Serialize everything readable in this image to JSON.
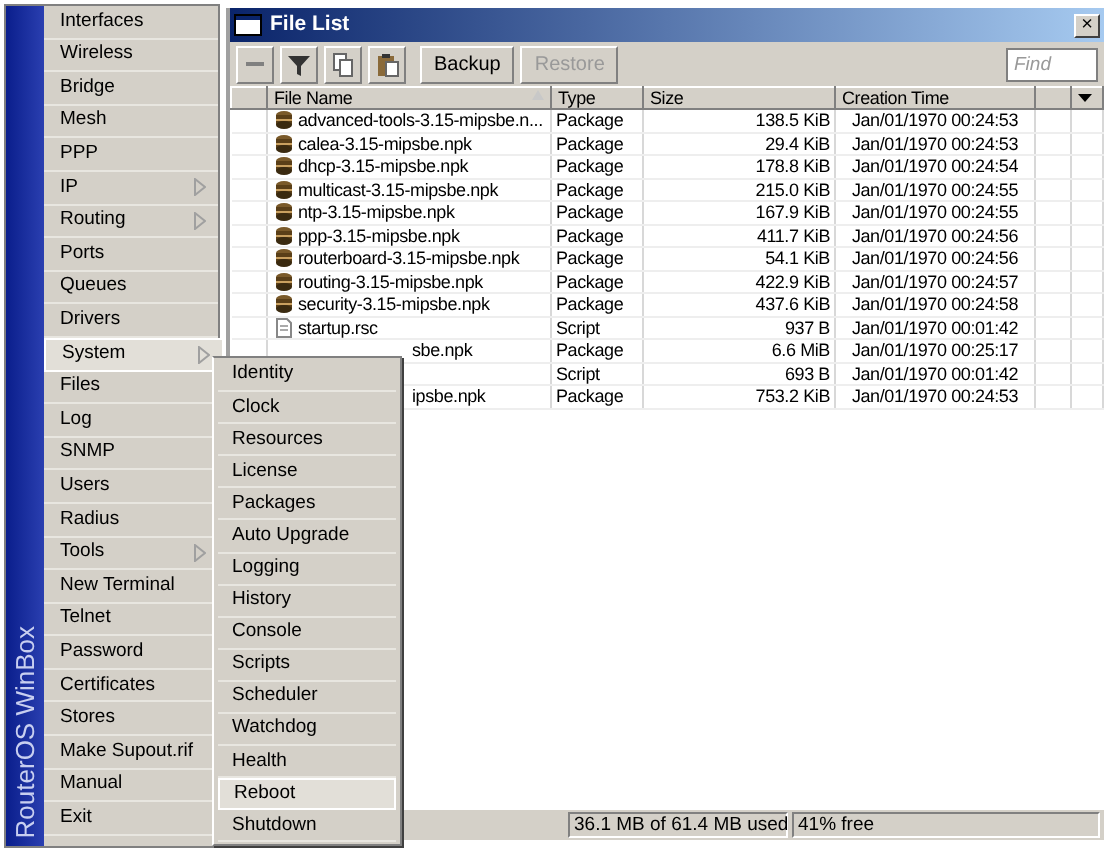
{
  "sidebar": {
    "brand": "RouterOS WinBox",
    "items": [
      {
        "label": "Interfaces",
        "submenu": false,
        "selected": false
      },
      {
        "label": "Wireless",
        "submenu": false,
        "selected": false
      },
      {
        "label": "Bridge",
        "submenu": false,
        "selected": false
      },
      {
        "label": "Mesh",
        "submenu": false,
        "selected": false
      },
      {
        "label": "PPP",
        "submenu": false,
        "selected": false
      },
      {
        "label": "IP",
        "submenu": true,
        "selected": false
      },
      {
        "label": "Routing",
        "submenu": true,
        "selected": false
      },
      {
        "label": "Ports",
        "submenu": false,
        "selected": false
      },
      {
        "label": "Queues",
        "submenu": false,
        "selected": false
      },
      {
        "label": "Drivers",
        "submenu": false,
        "selected": false
      },
      {
        "label": "System",
        "submenu": true,
        "selected": true
      },
      {
        "label": "Files",
        "submenu": false,
        "selected": false
      },
      {
        "label": "Log",
        "submenu": false,
        "selected": false
      },
      {
        "label": "SNMP",
        "submenu": false,
        "selected": false
      },
      {
        "label": "Users",
        "submenu": false,
        "selected": false
      },
      {
        "label": "Radius",
        "submenu": false,
        "selected": false
      },
      {
        "label": "Tools",
        "submenu": true,
        "selected": false
      },
      {
        "label": "New Terminal",
        "submenu": false,
        "selected": false
      },
      {
        "label": "Telnet",
        "submenu": false,
        "selected": false
      },
      {
        "label": "Password",
        "submenu": false,
        "selected": false
      },
      {
        "label": "Certificates",
        "submenu": false,
        "selected": false
      },
      {
        "label": "Stores",
        "submenu": false,
        "selected": false
      },
      {
        "label": "Make Supout.rif",
        "submenu": false,
        "selected": false
      },
      {
        "label": "Manual",
        "submenu": false,
        "selected": false
      },
      {
        "label": "Exit",
        "submenu": false,
        "selected": false
      }
    ]
  },
  "submenu": {
    "items": [
      {
        "label": "Identity",
        "selected": false
      },
      {
        "label": "Clock",
        "selected": false
      },
      {
        "label": "Resources",
        "selected": false
      },
      {
        "label": "License",
        "selected": false
      },
      {
        "label": "Packages",
        "selected": false
      },
      {
        "label": "Auto Upgrade",
        "selected": false
      },
      {
        "label": "Logging",
        "selected": false
      },
      {
        "label": "History",
        "selected": false
      },
      {
        "label": "Console",
        "selected": false
      },
      {
        "label": "Scripts",
        "selected": false
      },
      {
        "label": "Scheduler",
        "selected": false
      },
      {
        "label": "Watchdog",
        "selected": false
      },
      {
        "label": "Health",
        "selected": false
      },
      {
        "label": "Reboot",
        "selected": true
      },
      {
        "label": "Shutdown",
        "selected": false
      }
    ]
  },
  "window": {
    "title": "File List",
    "close": "×",
    "toolbar": {
      "buttons": [
        {
          "label": "Backup",
          "disabled": false
        },
        {
          "label": "Restore",
          "disabled": true
        }
      ],
      "find_placeholder": "Find"
    },
    "table": {
      "columns": [
        "File Name",
        "Type",
        "Size",
        "Creation Time"
      ],
      "rows": [
        {
          "kind": "package",
          "name": "advanced-tools-3.15-mipsbe.n...",
          "type": "Package",
          "size": "138.5 KiB",
          "time": "Jan/01/1970 00:24:53"
        },
        {
          "kind": "package",
          "name": "calea-3.15-mipsbe.npk",
          "type": "Package",
          "size": "29.4 KiB",
          "time": "Jan/01/1970 00:24:53"
        },
        {
          "kind": "package",
          "name": "dhcp-3.15-mipsbe.npk",
          "type": "Package",
          "size": "178.8 KiB",
          "time": "Jan/01/1970 00:24:54"
        },
        {
          "kind": "package",
          "name": "multicast-3.15-mipsbe.npk",
          "type": "Package",
          "size": "215.0 KiB",
          "time": "Jan/01/1970 00:24:55"
        },
        {
          "kind": "package",
          "name": "ntp-3.15-mipsbe.npk",
          "type": "Package",
          "size": "167.9 KiB",
          "time": "Jan/01/1970 00:24:55"
        },
        {
          "kind": "package",
          "name": "ppp-3.15-mipsbe.npk",
          "type": "Package",
          "size": "411.7 KiB",
          "time": "Jan/01/1970 00:24:56"
        },
        {
          "kind": "package",
          "name": "routerboard-3.15-mipsbe.npk",
          "type": "Package",
          "size": "54.1 KiB",
          "time": "Jan/01/1970 00:24:56"
        },
        {
          "kind": "package",
          "name": "routing-3.15-mipsbe.npk",
          "type": "Package",
          "size": "422.9 KiB",
          "time": "Jan/01/1970 00:24:57"
        },
        {
          "kind": "package",
          "name": "security-3.15-mipsbe.npk",
          "type": "Package",
          "size": "437.6 KiB",
          "time": "Jan/01/1970 00:24:58"
        },
        {
          "kind": "script",
          "name": "startup.rsc",
          "type": "Script",
          "size": "937 B",
          "time": "Jan/01/1970 00:01:42"
        },
        {
          "kind": "hidden",
          "name": "sbe.npk",
          "type": "Package",
          "size": "6.6 MiB",
          "time": "Jan/01/1970 00:25:17"
        },
        {
          "kind": "hidden",
          "type": "Script",
          "size": "693 B",
          "time": "Jan/01/1970 00:01:42"
        },
        {
          "kind": "hidden",
          "name": "ipsbe.npk",
          "type": "Package",
          "size": "753.2 KiB",
          "time": "Jan/01/1970 00:24:53"
        }
      ]
    },
    "status_bar": {
      "used": "36.1 MB of 61.4 MB used",
      "free": "41% free"
    }
  }
}
